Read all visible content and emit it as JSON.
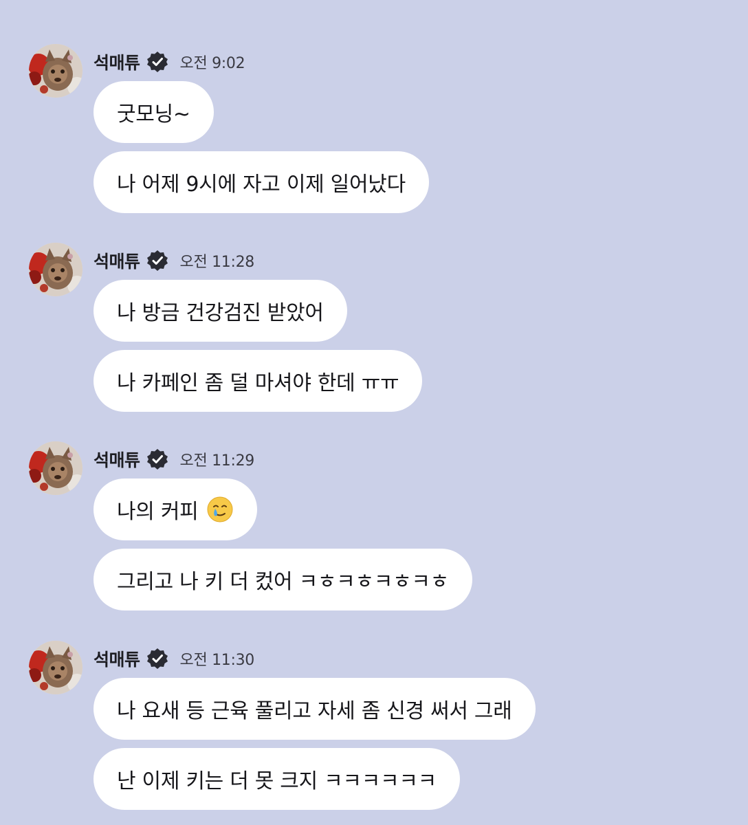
{
  "colors": {
    "background": "#cbd0e8",
    "bubble": "#ffffff",
    "verified_badge": "#2a2b33"
  },
  "groups": [
    {
      "sender": "석매튜",
      "time": "오전 9:02",
      "messages": [
        "굿모닝~",
        "나 어제 9시에 자고 이제 일어났다"
      ]
    },
    {
      "sender": "석매튜",
      "time": "오전 11:28",
      "messages": [
        "나 방금 건강검진 받았어",
        "나 카페인 좀 덜 마셔야 한데 ㅠㅠ"
      ]
    },
    {
      "sender": "석매튜",
      "time": "오전 11:29",
      "messages": [
        "나의 커피",
        "그리고 나 키 더 컸어 ㅋㅎㅋㅎㅋㅎㅋㅎ"
      ],
      "emoji": "smiling-face-with-tear-emoji"
    },
    {
      "sender": "석매튜",
      "time": "오전 11:30",
      "messages": [
        "나 요새 등 근육 풀리고 자세 좀 신경 써서 그래",
        "난 이제 키는 더 못 크지 ㅋㅋㅋㅋㅋㅋ"
      ]
    }
  ]
}
